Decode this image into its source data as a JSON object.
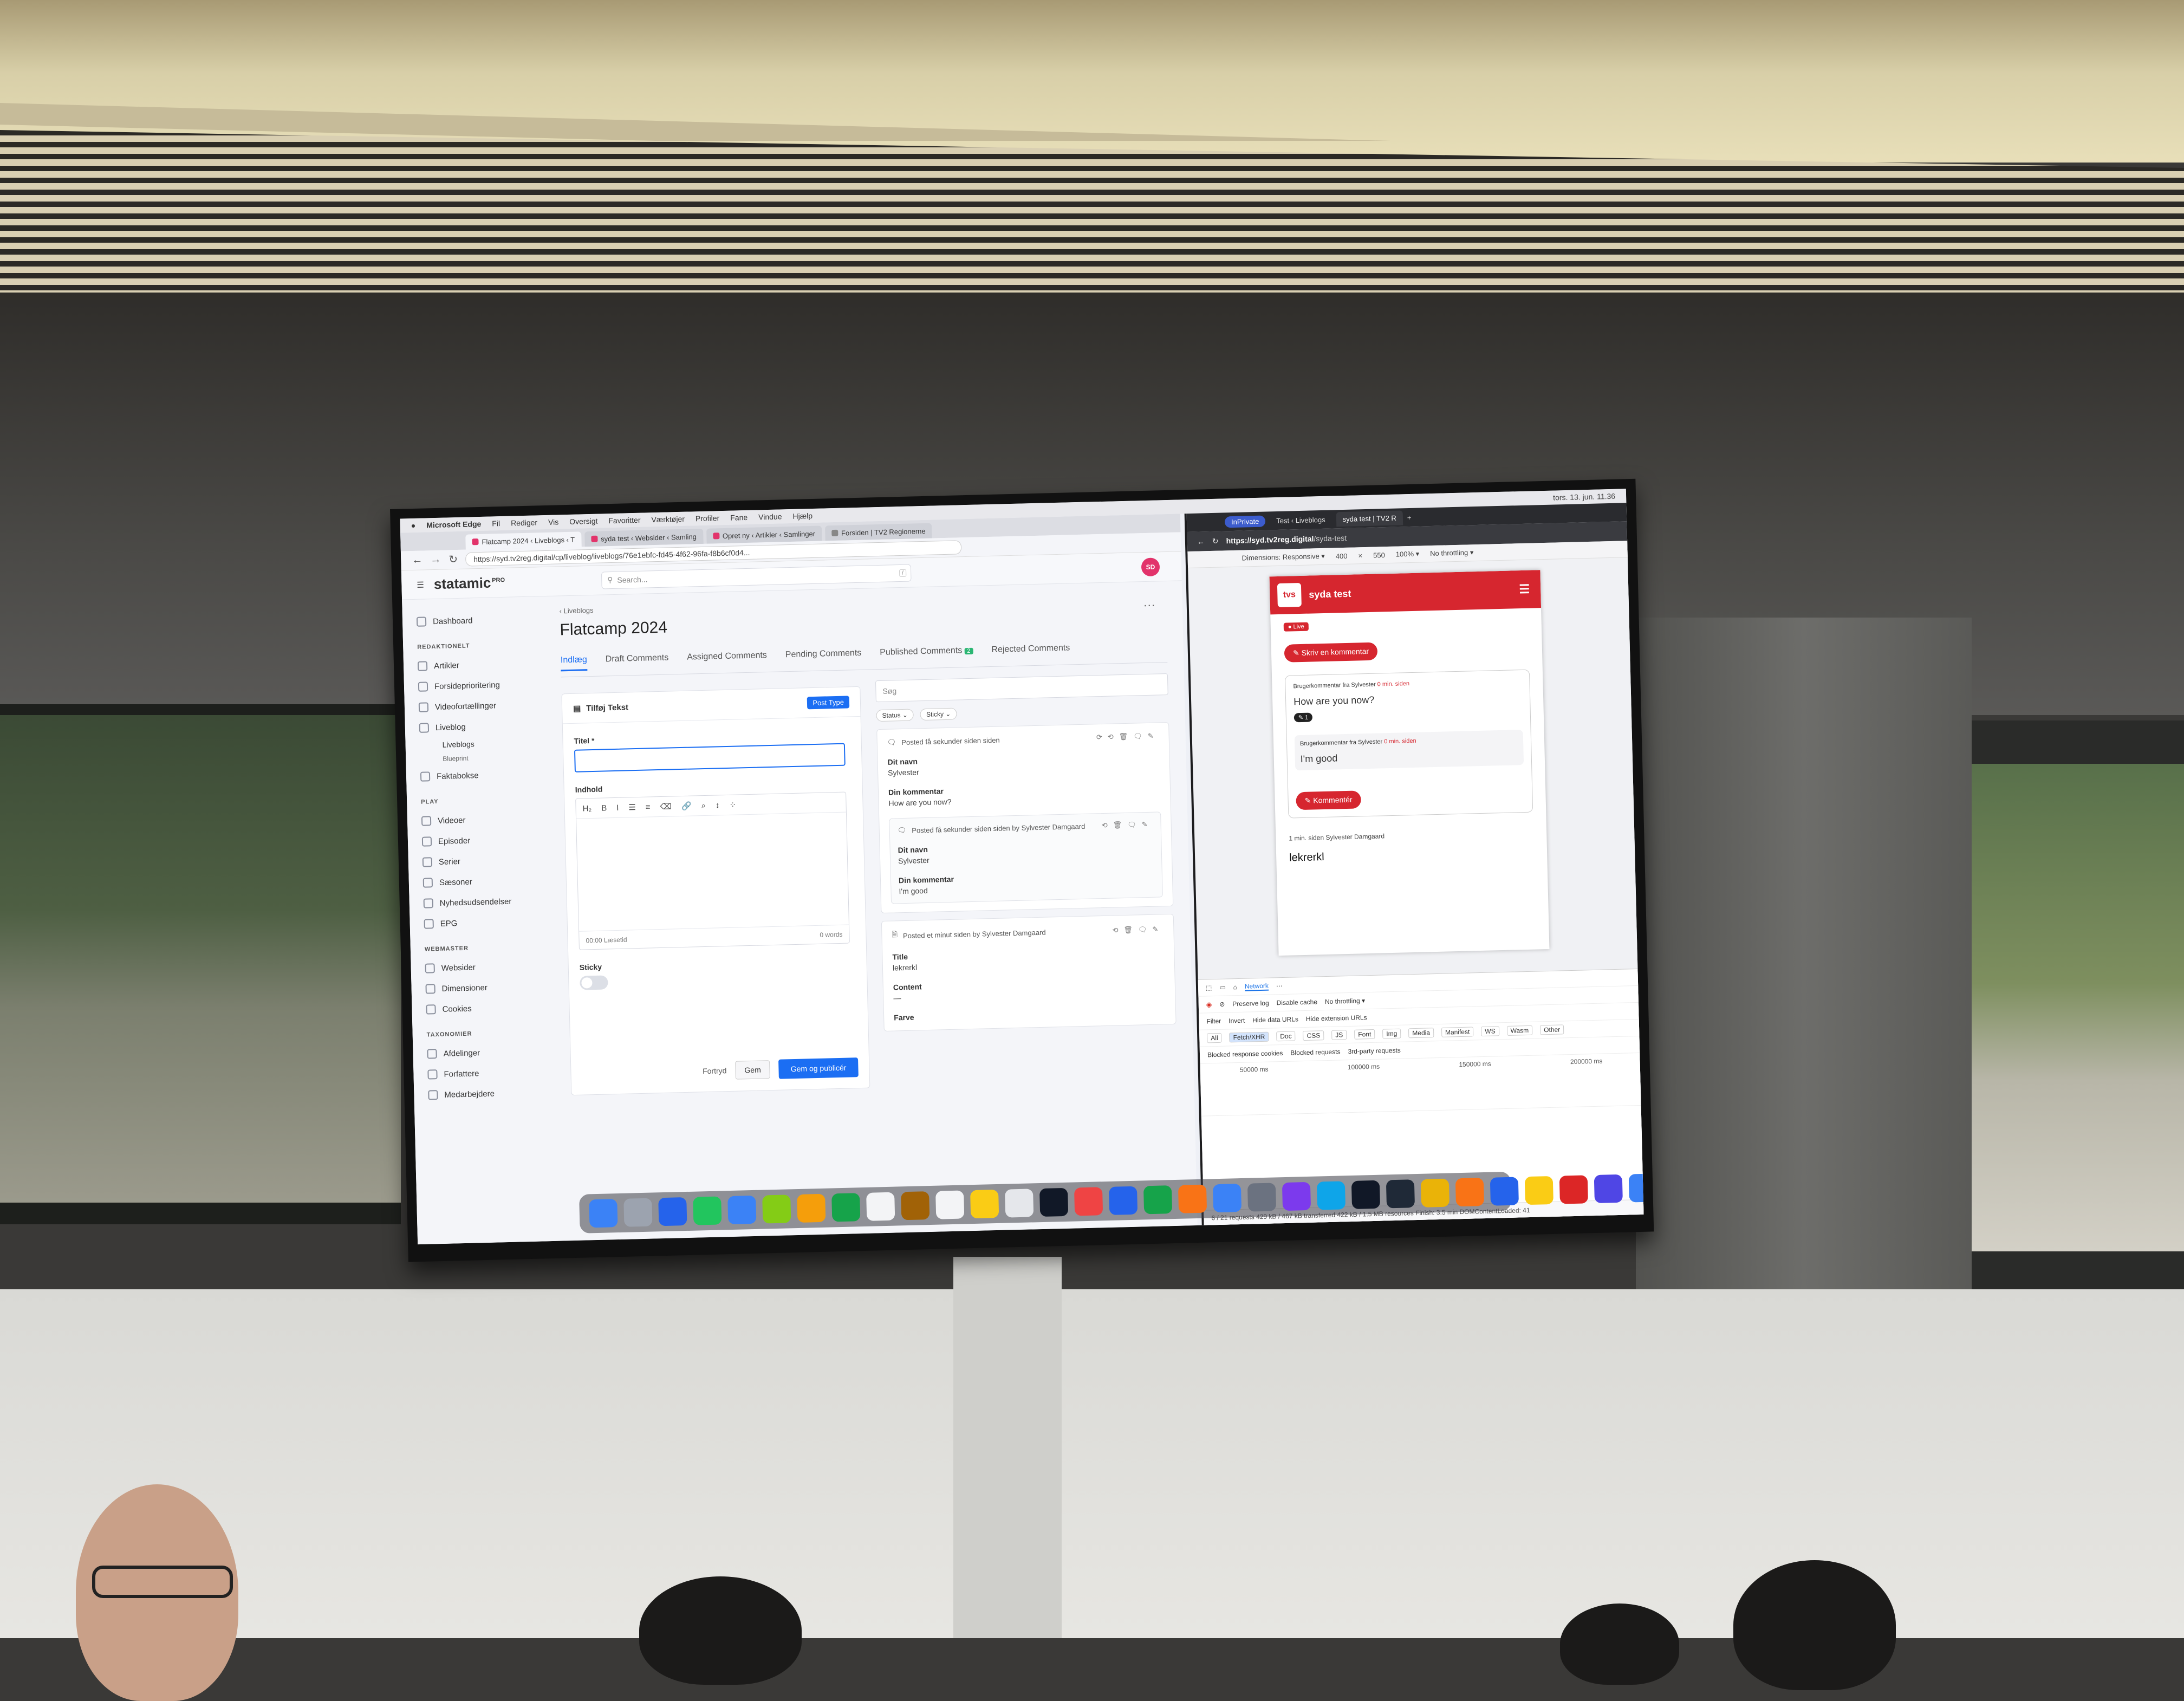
{
  "menubar": {
    "app": "Microsoft Edge",
    "items": [
      "Fil",
      "Rediger",
      "Vis",
      "Oversigt",
      "Favoritter",
      "Værktøjer",
      "Profiler",
      "Fane",
      "Vindue",
      "Hjælp"
    ],
    "clock": "tors. 13. jun. 11.36"
  },
  "edge": {
    "tabs": [
      {
        "label": "Flatcamp 2024 ‹ Liveblogs ‹ T"
      },
      {
        "label": "syda test ‹ Websider ‹ Samling"
      },
      {
        "label": "Opret ny ‹ Artikler ‹ Samlinger"
      },
      {
        "label": "Forsiden | TV2 Regionerne"
      }
    ],
    "url": "https://syd.tv2reg.digital/cp/liveblog/liveblogs/76e1ebfc-fd45-4f62-96fa-f8b6cf0d4..."
  },
  "statamic": {
    "logo": "statamic",
    "logo_sup": "PRO",
    "search_placeholder": "Search...",
    "search_kbd": "/",
    "avatar": "SD",
    "sidebar": {
      "dashboard": "Dashboard",
      "section_redaktionelt": "REDAKTIONELT",
      "redaktionelt": [
        "Artikler",
        "Forsideprioritering",
        "Videofortællinger",
        "Liveblog"
      ],
      "liveblog_sub": "Liveblogs",
      "liveblog_sub2": "Blueprint",
      "faktabokse": "Faktabokse",
      "section_play": "PLAY",
      "play": [
        "Videoer",
        "Episoder",
        "Serier",
        "Sæsoner",
        "Nyhedsudsendelser",
        "EPG"
      ],
      "section_webmaster": "WEBMASTER",
      "webmaster": [
        "Websider",
        "Dimensioner",
        "Cookies"
      ],
      "section_taxonomier": "TAXONOMIER",
      "taxonomier": [
        "Afdelinger",
        "Forfattere",
        "Medarbejdere"
      ]
    },
    "breadcrumb": "‹ Liveblogs",
    "page_title": "Flatcamp 2024",
    "more": "···",
    "tabs": [
      "Indlæg",
      "Draft Comments",
      "Assigned Comments",
      "Pending Comments",
      "Published Comments",
      "Rejected Comments"
    ],
    "published_badge": "2",
    "add_card": {
      "title": "Tilføj Tekst",
      "post_type": "Post Type",
      "titel_label": "Titel *",
      "indhold_label": "Indhold",
      "toolbar": [
        "H₂",
        "B",
        "I",
        "☰",
        "≡",
        "⌫",
        "🔗",
        "⌕",
        "↕",
        "⁘"
      ],
      "reading_time": "00:00 Læsetid",
      "words": "0 words",
      "sticky_label": "Sticky",
      "cancel": "Fortryd",
      "save": "Gem",
      "publish": "Gem og publicér"
    },
    "feed": {
      "search_placeholder": "Søg",
      "filters": [
        "Status ⌄",
        "Sticky ⌄"
      ],
      "post1": {
        "meta": "Posted få sekunder siden siden",
        "name_label": "Dit navn",
        "name": "Sylvester",
        "comment_label": "Din kommentar",
        "comment": "How are you now?",
        "reply": {
          "meta": "Posted få sekunder siden siden by Sylvester Damgaard",
          "name_label": "Dit navn",
          "name": "Sylvester",
          "comment_label": "Din kommentar",
          "comment": "I'm good"
        }
      },
      "post2": {
        "meta": "Posted et minut siden by Sylvester Damgaard",
        "title_label": "Title",
        "title": "lekrerkl",
        "content_label": "Content",
        "content": "—",
        "color_label": "Farve"
      }
    }
  },
  "chrome": {
    "inprivate": "InPrivate",
    "tabs": [
      "Test ‹ Liveblogs",
      "syda test | TV2 R"
    ],
    "url_host": "https://syd.tv2reg.digital",
    "url_path": "/syda-test",
    "devices": {
      "mode": "Dimensions: Responsive ▾",
      "width": "400",
      "x": "×",
      "height": "550",
      "zoom": "100% ▾",
      "throttle": "No throttling ▾"
    },
    "site": {
      "logo": "tvs",
      "title": "syda test",
      "live": "● Live",
      "write_comment": "✎ Skriv en kommentar",
      "comment_by": "Brugerkommentar fra Sylvester",
      "comment_ago": "0 min. siden",
      "comment_body": "How are you now?",
      "comment_count": "✎ 1",
      "reply_by": "Brugerkommentar fra Sylvester",
      "reply_ago": "0 min. siden",
      "reply_body": "I'm good",
      "kommenter": "✎ Kommentér",
      "entry_meta": "1 min. siden   Sylvester Damgaard",
      "entry_title": "lekrerkl"
    },
    "devtools": {
      "tabs": [
        "Network"
      ],
      "options": [
        "Preserve log",
        "Disable cache",
        "No throttling ▾"
      ],
      "filter_placeholder": "Filter",
      "filter_opts": [
        "Invert",
        "Hide data URLs",
        "Hide extension URLs"
      ],
      "chips": [
        "All",
        "Fetch/XHR",
        "Doc",
        "CSS",
        "JS",
        "Font",
        "Img",
        "Media",
        "Manifest",
        "WS",
        "Wasm",
        "Other"
      ],
      "blocked": [
        "Blocked response cookies",
        "Blocked requests",
        "3rd-party requests"
      ],
      "timeline": [
        "50000 ms",
        "100000 ms",
        "150000 ms",
        "200000 ms"
      ],
      "status": "6 / 21 requests   429 kB / 467 kB transferred   422 kB / 1.5 MB resources   Finish: 3.5 min   DOMContentLoaded: 41"
    }
  },
  "dock": {
    "apps": [
      "finder-icon",
      "launchpad-icon",
      "safari-icon",
      "messages-icon",
      "mail-icon",
      "maps-icon",
      "photos-icon",
      "facetime-icon",
      "calendar-icon",
      "contacts-icon",
      "reminders-icon",
      "notes-icon",
      "freeform-icon",
      "tv-icon",
      "music-icon",
      "keynote-icon",
      "numbers-icon",
      "pages-icon",
      "app-store-icon",
      "system-settings-icon",
      "slack-icon",
      "edge-icon",
      "phpstorm-icon",
      "terminal-icon",
      "tableplus-icon",
      "pen-icon",
      "outlook-icon",
      "duck-icon",
      "h-app-icon",
      "discord-icon",
      "signal-icon",
      "documents-icon",
      "trash-icon"
    ],
    "colors": [
      "#3b82f6",
      "#9ca3af",
      "#2563eb",
      "#22c55e",
      "#3b82f6",
      "#84cc16",
      "#f59e0b",
      "#16a34a",
      "#f3f4f6",
      "#a16207",
      "#f3f4f6",
      "#facc15",
      "#e5e7eb",
      "#111827",
      "#ef4444",
      "#2563eb",
      "#16a34a",
      "#f97316",
      "#3b82f6",
      "#6b7280",
      "#7c3aed",
      "#0ea5e9",
      "#111827",
      "#1f2937",
      "#eab308",
      "#f97316",
      "#2563eb",
      "#facc15",
      "#dc2626",
      "#4f46e5",
      "#3b82f6",
      "#e5e7eb",
      "#d1d5db"
    ]
  }
}
